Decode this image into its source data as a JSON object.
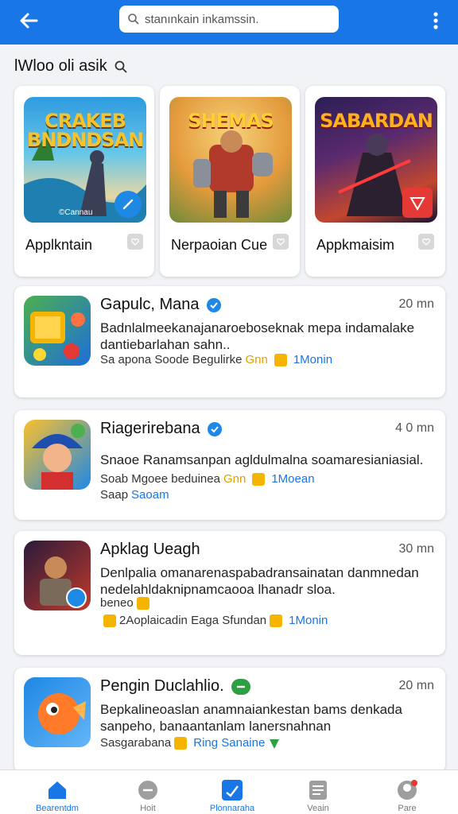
{
  "header": {
    "search_text": "stanınkain inkamssin."
  },
  "section": {
    "title": "lWloo oli asik"
  },
  "featured": [
    {
      "thumb_title": "CRAKEB BNDNDSAN",
      "thumb_caption": "©Cannau",
      "name": "Applkntain"
    },
    {
      "thumb_title": "SHEMAS",
      "name": "Nerpaoian Cue"
    },
    {
      "thumb_title": "SABARDAN",
      "name": "Appkmaisim"
    }
  ],
  "list": [
    {
      "title": "Gapulc, Mana",
      "size": "20 mn",
      "desc": "Badnlalmeekanajanaroeboseknak mepa indamalake dantiebarlahan sahn..",
      "meta": {
        "a": "Sa apona Soode Begulirke",
        "b": "Gnn",
        "c": "1Monin"
      }
    },
    {
      "title": "Riagerirebana",
      "size": "4 0 mn",
      "desc": "Snaoe Ranamsanpan agldulmalna soamaresianiasial.",
      "meta": {
        "a": "Soab  Mgoee beduinea",
        "b": "Gnn",
        "c": "1Moean"
      },
      "meta2": {
        "a": "Saap",
        "b": "Saoam"
      }
    },
    {
      "title": "Apklag Ueagh",
      "size": "30 mn",
      "desc": "Denlpalia omanarenaspabadransainatan danmnedan nedelahldaknipnamcaooa lhanadr sloa.",
      "meta0": {
        "a": "beneo"
      },
      "meta": {
        "a": "2Aoplaicadin Eaga Sfundan",
        "c": "1Monin"
      }
    },
    {
      "title": "Pengin Duclahlio.",
      "size": "20 mn",
      "desc": "Bepkalineoaslan anamnaiankestan bams denkada sanpeho, banaantanlam lanersnahnan",
      "meta": {
        "a": "Sasgarabana",
        "b": "Ring Sanaine"
      }
    }
  ],
  "nav": [
    {
      "label": "Bearentdm"
    },
    {
      "label": "Hoit"
    },
    {
      "label": "Plonnaraha"
    },
    {
      "label": "Veain"
    },
    {
      "label": "Pare"
    }
  ]
}
